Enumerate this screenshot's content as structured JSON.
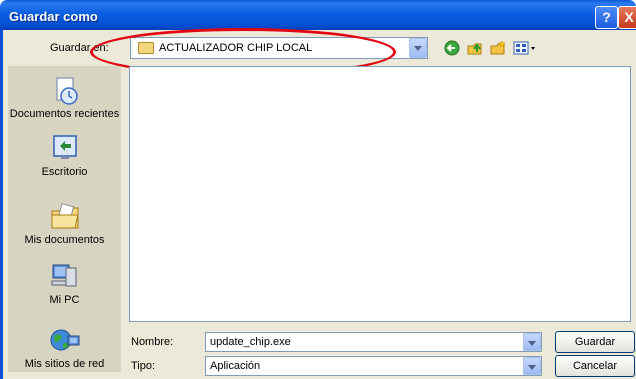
{
  "window": {
    "title": "Guardar como"
  },
  "title_buttons": {
    "help": "?",
    "close": "X"
  },
  "toolbar": {
    "look_in_label": "Guardar en:",
    "look_in_value": "ACTUALIZADOR CHIP LOCAL",
    "icons": [
      "back-icon",
      "up-folder-icon",
      "new-folder-icon",
      "view-menu-icon"
    ]
  },
  "places": [
    {
      "label": "Documentos recientes",
      "icon": "recent-documents-icon"
    },
    {
      "label": "Escritorio",
      "icon": "desktop-icon"
    },
    {
      "label": "Mis documentos",
      "icon": "my-documents-icon"
    },
    {
      "label": "Mi PC",
      "icon": "my-computer-icon"
    },
    {
      "label": "Mis sitios de red",
      "icon": "network-places-icon"
    }
  ],
  "form": {
    "filename_label": "Nombre:",
    "filename_value": "update_chip.exe",
    "type_label": "Tipo:",
    "type_value": "Aplicación"
  },
  "buttons": {
    "save": "Guardar",
    "cancel": "Cancelar"
  },
  "colors": {
    "titlebar": "#0b5fe0",
    "annotation_oval": "#e30613",
    "dialog_bg": "#ece9d8"
  }
}
